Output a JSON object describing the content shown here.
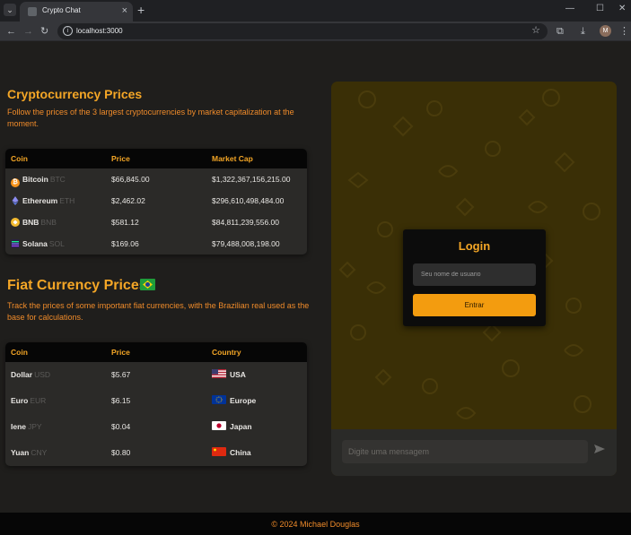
{
  "browser": {
    "tab_title": "Crypto Chat",
    "url": "localhost:3000",
    "profile_initial": "M"
  },
  "crypto": {
    "title": "Cryptocurrency Prices",
    "description": "Follow the prices of the 3 largest cryptocurrencies by market capitalization at the moment.",
    "headers": [
      "Coin",
      "Price",
      "Market Cap"
    ],
    "rows": [
      {
        "name": "Bitcoin",
        "symbol": "BTC",
        "price": "$66,845.00",
        "market_cap": "$1,322,367,156,215.00",
        "icon": "bitcoin-icon",
        "color": "#f7931a"
      },
      {
        "name": "Ethereum",
        "symbol": "ETH",
        "price": "$2,462.02",
        "market_cap": "$296,610,498,484.00",
        "icon": "ethereum-icon",
        "color": "#627eea"
      },
      {
        "name": "BNB",
        "symbol": "BNB",
        "price": "$581.12",
        "market_cap": "$84,811,239,556.00",
        "icon": "bnb-icon",
        "color": "#f3ba2f"
      },
      {
        "name": "Solana",
        "symbol": "SOL",
        "price": "$169.06",
        "market_cap": "$79,488,008,198.00",
        "icon": "solana-icon",
        "color": "#14f195"
      }
    ]
  },
  "fiat": {
    "title": "Fiat Currency Prices",
    "title_flag": "brazil-flag-icon",
    "description": "Track the prices of some important fiat currencies, with the Brazilian real used as the base for calculations.",
    "headers": [
      "Coin",
      "Price",
      "Country"
    ],
    "rows": [
      {
        "name": "Dollar",
        "symbol": "USD",
        "price": "$5.67",
        "country": "USA",
        "flag": "usa-flag-icon"
      },
      {
        "name": "Euro",
        "symbol": "EUR",
        "price": "$6.15",
        "country": "Europe",
        "flag": "eu-flag-icon"
      },
      {
        "name": "Iene",
        "symbol": "JPY",
        "price": "$0.04",
        "country": "Japan",
        "flag": "japan-flag-icon"
      },
      {
        "name": "Yuan",
        "symbol": "CNY",
        "price": "$0.80",
        "country": "China",
        "flag": "china-flag-icon"
      }
    ]
  },
  "chat": {
    "message_placeholder": "Digite uma mensagem",
    "login": {
      "title": "Login",
      "username_placeholder": "Seu nome de usuario",
      "button": "Entrar"
    }
  },
  "footer": {
    "text": "© 2024 Michael Douglas"
  },
  "colors": {
    "accent": "#f4a626",
    "accent_alt": "#f08b2a",
    "button": "#f39c0f",
    "background": "#1f1e1c",
    "chat_background": "#3a2f06"
  }
}
